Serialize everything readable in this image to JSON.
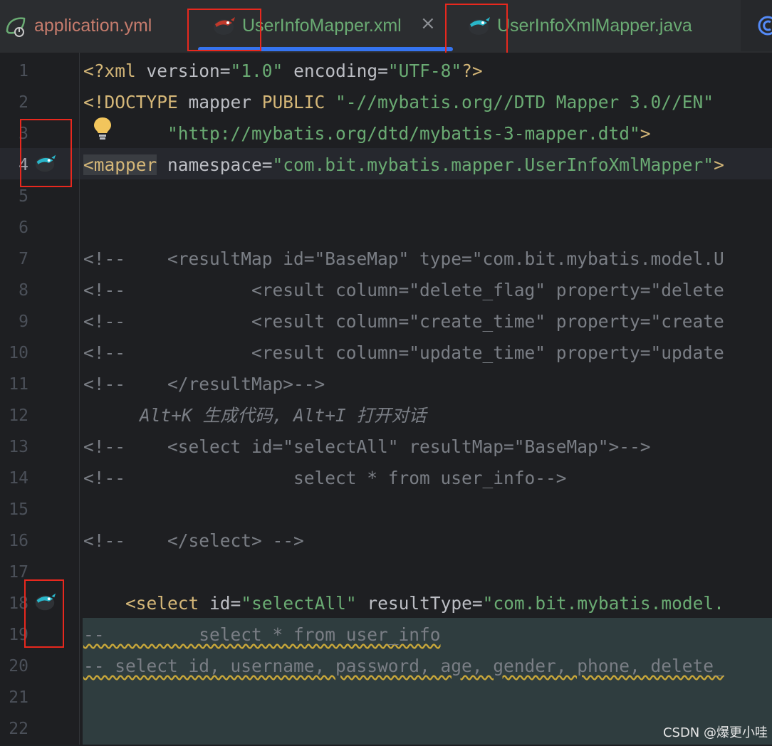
{
  "tabs": [
    {
      "label": "application.yml",
      "icon": "spring-leaf-icon",
      "color": "#c77c6d"
    },
    {
      "label": "UserInfoMapper.xml",
      "icon": "mybatis-bird-icon",
      "color": "#6aab73",
      "active": true
    },
    {
      "label": "UserInfoXmlMapper.java",
      "icon": "mybatis-bird-icon",
      "color": "#6aab73"
    },
    {
      "label": "",
      "icon": "class-c-icon"
    }
  ],
  "close_glyph": "×",
  "line_numbers": [
    "1",
    "2",
    "3",
    "4",
    "5",
    "6",
    "7",
    "8",
    "9",
    "10",
    "11",
    "12",
    "13",
    "14",
    "15",
    "16",
    "17",
    "18",
    "19",
    "20",
    "21",
    "22"
  ],
  "code": {
    "l1": {
      "a": "<?xml ",
      "b": "version",
      "c": "=",
      "d": "\"1.0\"",
      "e": " encoding",
      "f": "=",
      "g": "\"UTF-8\"",
      "h": "?>"
    },
    "l2": {
      "a": "<!DOCTYPE ",
      "b": "mapper ",
      "c": "PUBLIC ",
      "d": "\"-//mybatis.org//DTD Mapper 3.0//EN\""
    },
    "l3": {
      "a": "\"http://mybatis.org/dtd/mybatis-3-mapper.dtd\"",
      "b": ">"
    },
    "l4": {
      "a": "<mapper",
      "b": " namespace",
      "c": "=",
      "d": "\"com.bit.mybatis.mapper.UserInfoXmlMapper\"",
      "e": ">"
    },
    "l7": "<!--    <resultMap id=\"BaseMap\" type=\"com.bit.mybatis.model.U",
    "l8": "<!--            <result column=\"delete_flag\" property=\"delete",
    "l9": "<!--            <result column=\"create_time\" property=\"create",
    "l10": "<!--            <result column=\"update_time\" property=\"update",
    "l11": "<!--    </resultMap>-->",
    "l12": "Alt+K 生成代码, Alt+I 打开对话",
    "l13": "<!--    <select id=\"selectAll\" resultMap=\"BaseMap\">-->",
    "l14": "<!--                select * from user_info-->",
    "l16": "<!--    </select> -->",
    "l18": {
      "a": "<select",
      "b": " id",
      "c": "=",
      "d": "\"selectAll\"",
      "e": " resultType",
      "f": "=",
      "g": "\"com.bit.mybatis.model."
    },
    "l19": "--         select * from user_info",
    "l20": "-- select id, username, password, age, gender, phone, delete_"
  },
  "watermark": "CSDN @爆更小哇",
  "colors": {
    "tag": "#d5b778",
    "string": "#6aab73",
    "comment": "#7a7e85",
    "text": "#bcbec4",
    "accent": "#3574f0",
    "annotation_box": "#e8281e"
  }
}
